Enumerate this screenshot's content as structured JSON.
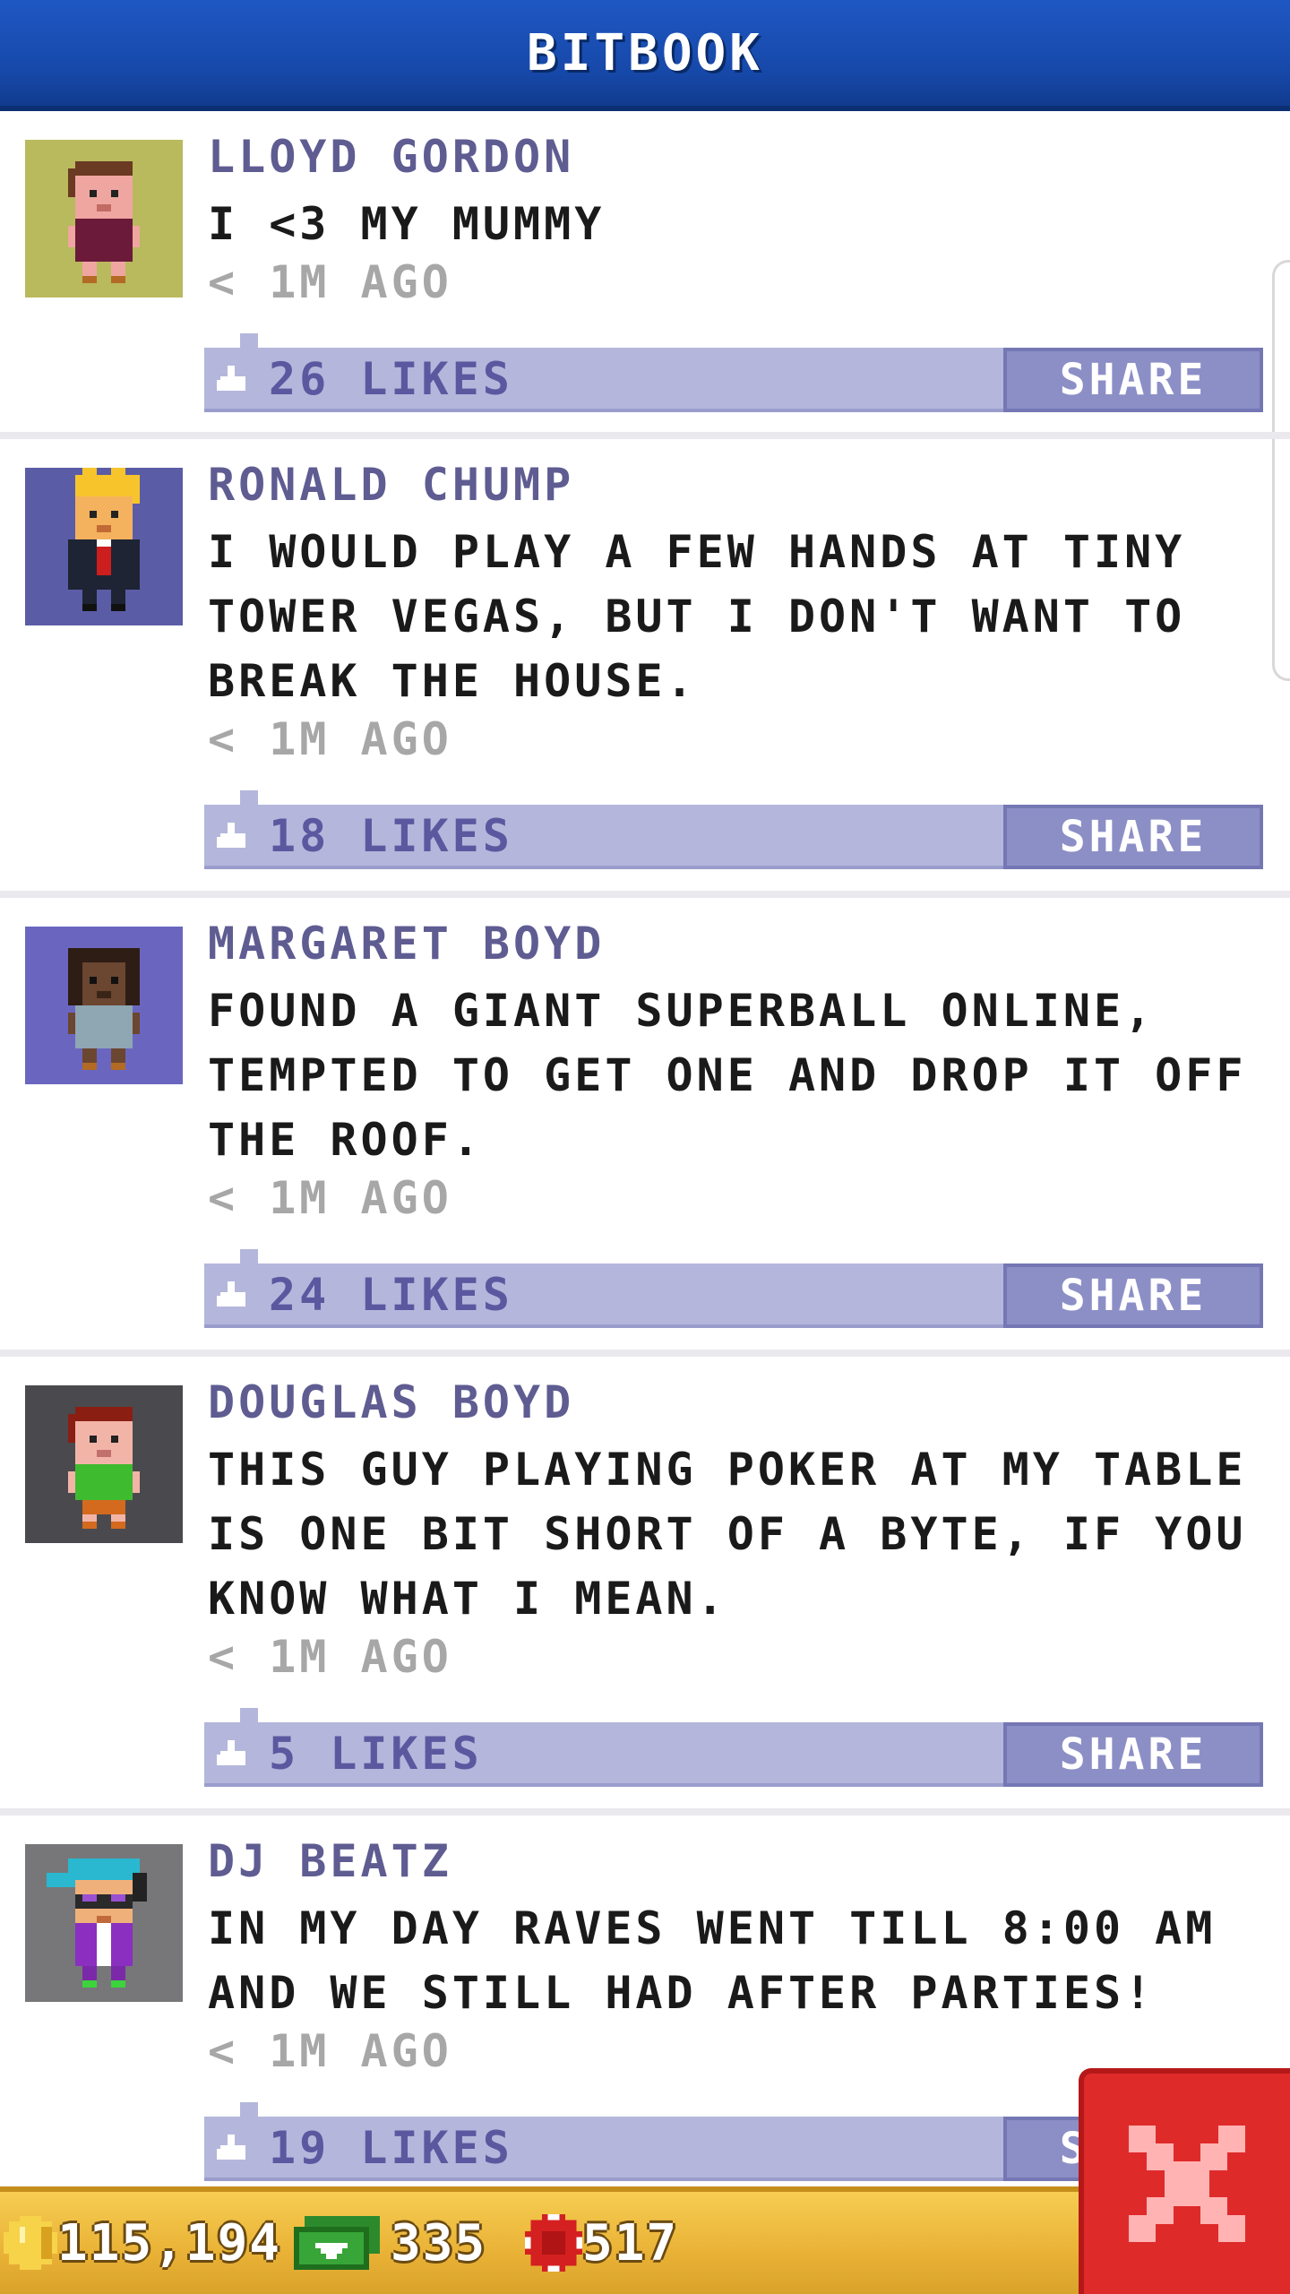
{
  "header": {
    "title": "BITBOOK"
  },
  "posts": [
    {
      "name": "LLOYD GORDON",
      "text": "I <3 MY MUMMY",
      "time": "< 1M AGO",
      "likes": "26 LIKES",
      "share_label": "SHARE",
      "avatar": "avatar-lloyd-gordon",
      "avatar_bg": "#b9b95e"
    },
    {
      "name": "RONALD CHUMP",
      "text": "I WOULD PLAY A FEW HANDS AT TINY TOWER VEGAS, BUT I DON'T WANT TO BREAK THE HOUSE.",
      "time": "< 1M AGO",
      "likes": "18 LIKES",
      "share_label": "SHARE",
      "avatar": "avatar-ronald-chump",
      "avatar_bg": "#5b5ca6"
    },
    {
      "name": "MARGARET BOYD",
      "text": "FOUND A GIANT SUPERBALL ONLINE, TEMPTED TO GET ONE AND DROP IT OFF THE ROOF.",
      "time": "< 1M AGO",
      "likes": "24 LIKES",
      "share_label": "SHARE",
      "avatar": "avatar-margaret-boyd",
      "avatar_bg": "#6a66c0"
    },
    {
      "name": "DOUGLAS BOYD",
      "text": "THIS GUY PLAYING POKER AT MY TABLE IS ONE BIT SHORT OF A BYTE, IF YOU KNOW WHAT I MEAN.",
      "time": "< 1M AGO",
      "likes": "5 LIKES",
      "share_label": "SHARE",
      "avatar": "avatar-douglas-boyd",
      "avatar_bg": "#4a4a4e"
    },
    {
      "name": "DJ BEATZ",
      "text": "IN MY DAY RAVES WENT TILL 8:00 AM AND WE STILL HAD AFTER PARTIES!",
      "time": "< 1M AGO",
      "likes": "19 LIKES",
      "share_label": "SHARE",
      "avatar": "avatar-dj-beatz",
      "avatar_bg": "#77777a"
    }
  ],
  "status": {
    "coins": "115,194",
    "bux": "335",
    "chips": "517"
  },
  "icons": {
    "like": "thumb-up-icon",
    "coins": "coin-icon",
    "bux": "bux-icon",
    "chips": "poker-chip-icon",
    "close": "close-icon"
  },
  "colors": {
    "header": "#1f57c3",
    "name": "#5f5c92",
    "likes_bar": "#b4b7db",
    "share": "#8c8fc6",
    "status_bar": "#e9b236",
    "close": "#df2a2a"
  }
}
